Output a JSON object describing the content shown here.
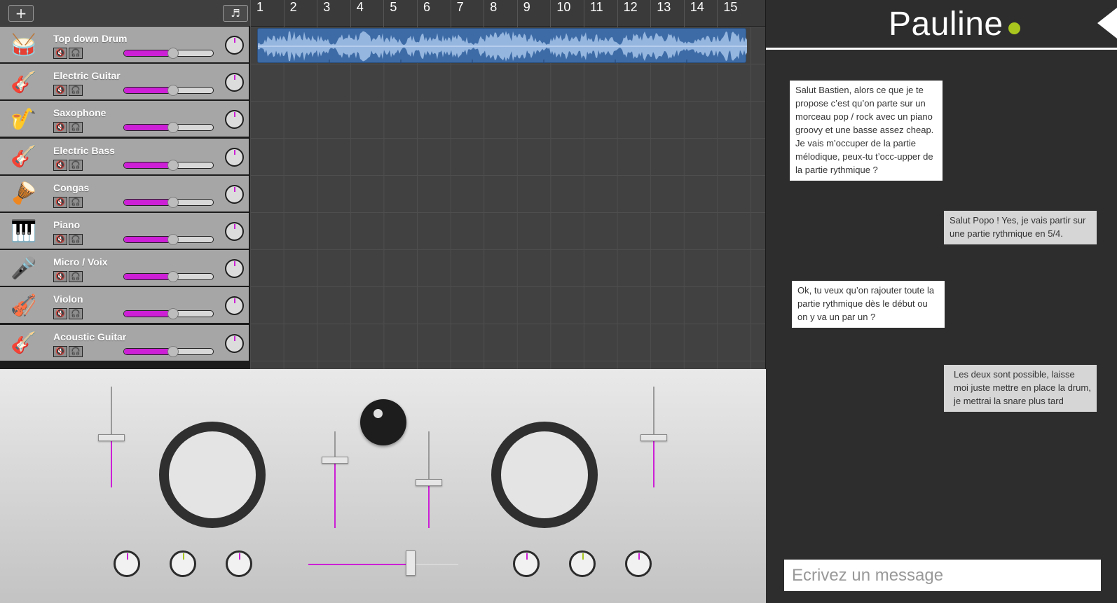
{
  "toolbar": {
    "add_label": "+",
    "metronome_label": "♬"
  },
  "ruler": [
    "1",
    "2",
    "3",
    "4",
    "5",
    "6",
    "7",
    "8",
    "9",
    "10",
    "11",
    "12",
    "13",
    "14",
    "15"
  ],
  "tracks": [
    {
      "name": "Top down Drum",
      "icon": "🥁",
      "volume": 0.55
    },
    {
      "name": "Electric Guitar",
      "icon": "🎸",
      "volume": 0.55
    },
    {
      "name": "Saxophone",
      "icon": "🎷",
      "volume": 0.55
    },
    {
      "name": "Electric Bass",
      "icon": "🎸",
      "volume": 0.55
    },
    {
      "name": "Congas",
      "icon": "🪘",
      "volume": 0.55
    },
    {
      "name": "Piano",
      "icon": "🎹",
      "volume": 0.55
    },
    {
      "name": "Micro / Voix",
      "icon": "🎤",
      "volume": 0.55
    },
    {
      "name": "Violon",
      "icon": "🎻",
      "volume": 0.55
    },
    {
      "name": "Acoustic Guitar",
      "icon": "🎸",
      "volume": 0.55
    }
  ],
  "track_buttons": {
    "mute": "🔇",
    "solo": "🎧"
  },
  "region": {
    "track": "Top down Drum",
    "color": "#3d6ba6"
  },
  "mixer": {
    "accent": "#cc1fd6",
    "secondary": "#a8c61d",
    "crossfader": 0.68
  },
  "chat": {
    "contact": "Pauline",
    "status_color": "#a8c61d",
    "messages": [
      {
        "from": "Pauline",
        "text": "Salut Bastien, alors ce que je te propose c’est qu’on parte sur un morceau pop / rock avec un piano groovy et une basse assez cheap. Je vais m’occuper de la partie mélodique, peux-tu t’occ-upper de la partie rythmique ?"
      },
      {
        "from": "me",
        "text": "Salut Popo ! Yes, je vais partir sur une partie rythmique en 5/4."
      },
      {
        "from": "Pauline",
        "text": "Ok, tu veux qu’on rajouter toute la partie rythmique dès le début ou on y va un par un ?"
      },
      {
        "from": "me",
        "text": "Les deux sont possible, laisse moi juste mettre en place la drum, je mettrai la snare plus tard"
      }
    ],
    "input_placeholder": "Ecrivez un message"
  }
}
